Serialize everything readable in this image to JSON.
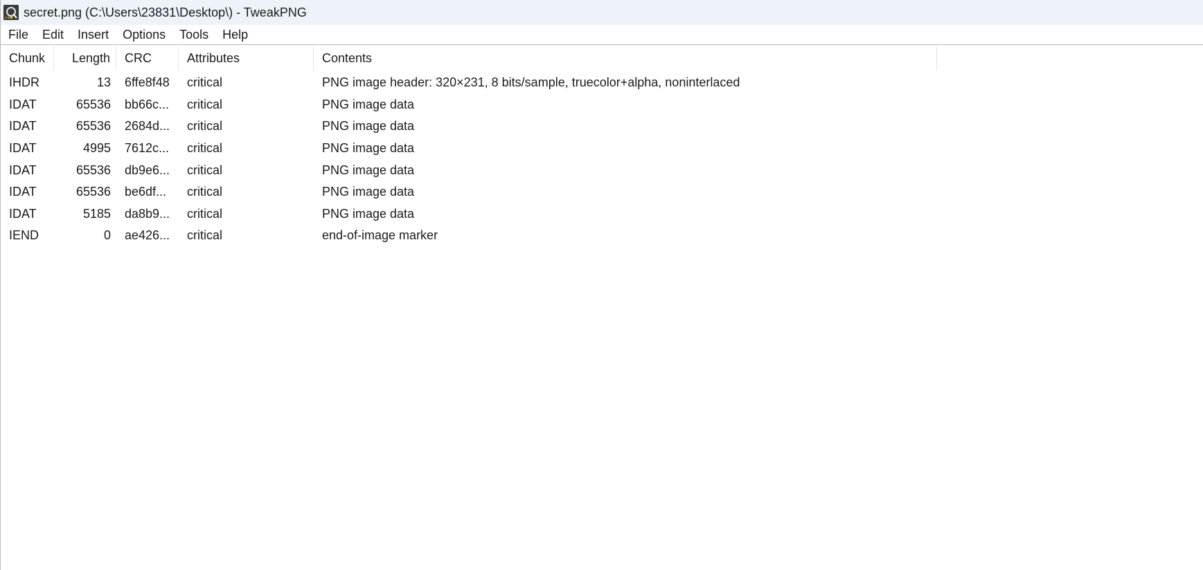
{
  "window": {
    "title": "secret.png (C:\\Users\\23831\\Desktop\\) - TweakPNG",
    "icon": "tweakpng-app-icon"
  },
  "menu": {
    "items": [
      {
        "label": "File"
      },
      {
        "label": "Edit"
      },
      {
        "label": "Insert"
      },
      {
        "label": "Options"
      },
      {
        "label": "Tools"
      },
      {
        "label": "Help"
      }
    ]
  },
  "table": {
    "columns": [
      {
        "label": "Chunk"
      },
      {
        "label": "Length"
      },
      {
        "label": "CRC"
      },
      {
        "label": "Attributes"
      },
      {
        "label": "Contents"
      }
    ],
    "rows": [
      {
        "chunk": "IHDR",
        "length": "13",
        "crc": "6ffe8f48",
        "attributes": "critical",
        "contents": "PNG image header: 320×231, 8 bits/sample, truecolor+alpha, noninterlaced"
      },
      {
        "chunk": "IDAT",
        "length": "65536",
        "crc": "bb66c...",
        "attributes": "critical",
        "contents": "PNG image data"
      },
      {
        "chunk": "IDAT",
        "length": "65536",
        "crc": "2684d...",
        "attributes": "critical",
        "contents": "PNG image data"
      },
      {
        "chunk": "IDAT",
        "length": "4995",
        "crc": "7612c...",
        "attributes": "critical",
        "contents": "PNG image data"
      },
      {
        "chunk": "IDAT",
        "length": "65536",
        "crc": "db9e6...",
        "attributes": "critical",
        "contents": "PNG image data"
      },
      {
        "chunk": "IDAT",
        "length": "65536",
        "crc": "be6df...",
        "attributes": "critical",
        "contents": "PNG image data"
      },
      {
        "chunk": "IDAT",
        "length": "5185",
        "crc": "da8b9...",
        "attributes": "critical",
        "contents": "PNG image data"
      },
      {
        "chunk": "IEND",
        "length": "0",
        "crc": "ae426...",
        "attributes": "critical",
        "contents": "end-of-image marker"
      }
    ]
  }
}
